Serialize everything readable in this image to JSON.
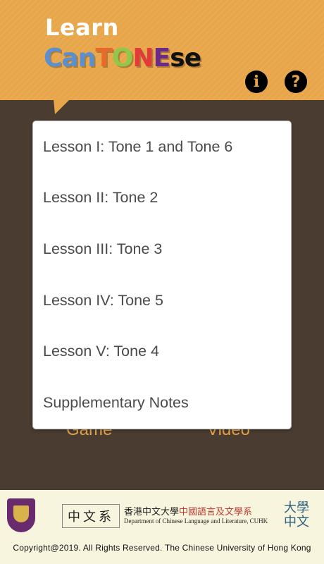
{
  "header": {
    "learn_label": "Learn",
    "brand_parts": [
      {
        "text": "C",
        "color": "#5a8fd0"
      },
      {
        "text": "a",
        "color": "#5a8fd0"
      },
      {
        "text": "n",
        "color": "#5a8fd0"
      },
      {
        "text": "T",
        "color": "#e86a2a"
      },
      {
        "text": "O",
        "color": "#8fc94a"
      },
      {
        "text": "N",
        "color": "#e23a3a"
      },
      {
        "text": "E",
        "color": "#6a2a8a"
      },
      {
        "text": "s",
        "color": "#111111"
      },
      {
        "text": "e",
        "color": "#111111"
      }
    ],
    "info_icon": "info-icon",
    "help_icon": "help-icon",
    "info_glyph": "i",
    "help_glyph": "?"
  },
  "background_buttons": {
    "game_label": "Game",
    "video_label": "Video"
  },
  "menu": {
    "items": [
      {
        "label": "Lesson I: Tone 1 and Tone 6"
      },
      {
        "label": "Lesson II: Tone 2"
      },
      {
        "label": "Lesson III: Tone 3"
      },
      {
        "label": "Lesson IV: Tone 5"
      },
      {
        "label": "Lesson V: Tone 4"
      },
      {
        "label": "Supplementary Notes"
      }
    ]
  },
  "footer": {
    "dept_seal": "中文系",
    "dept_cn_black": "香港中文大學",
    "dept_cn_red": "中國語言及文學系",
    "dept_en": "Department of Chinese Language and Literature, CUHK",
    "right_logo_top": "大學",
    "right_logo_bottom": "中文",
    "copyright": "Copyright@2019. All Rights Reserved. The Chinese University of Hong Kong"
  },
  "colors": {
    "header_bg": "#e8a64a",
    "body_bg": "#4a3c31",
    "footer_bg": "#f7f5de",
    "accent": "#e8a64a"
  }
}
